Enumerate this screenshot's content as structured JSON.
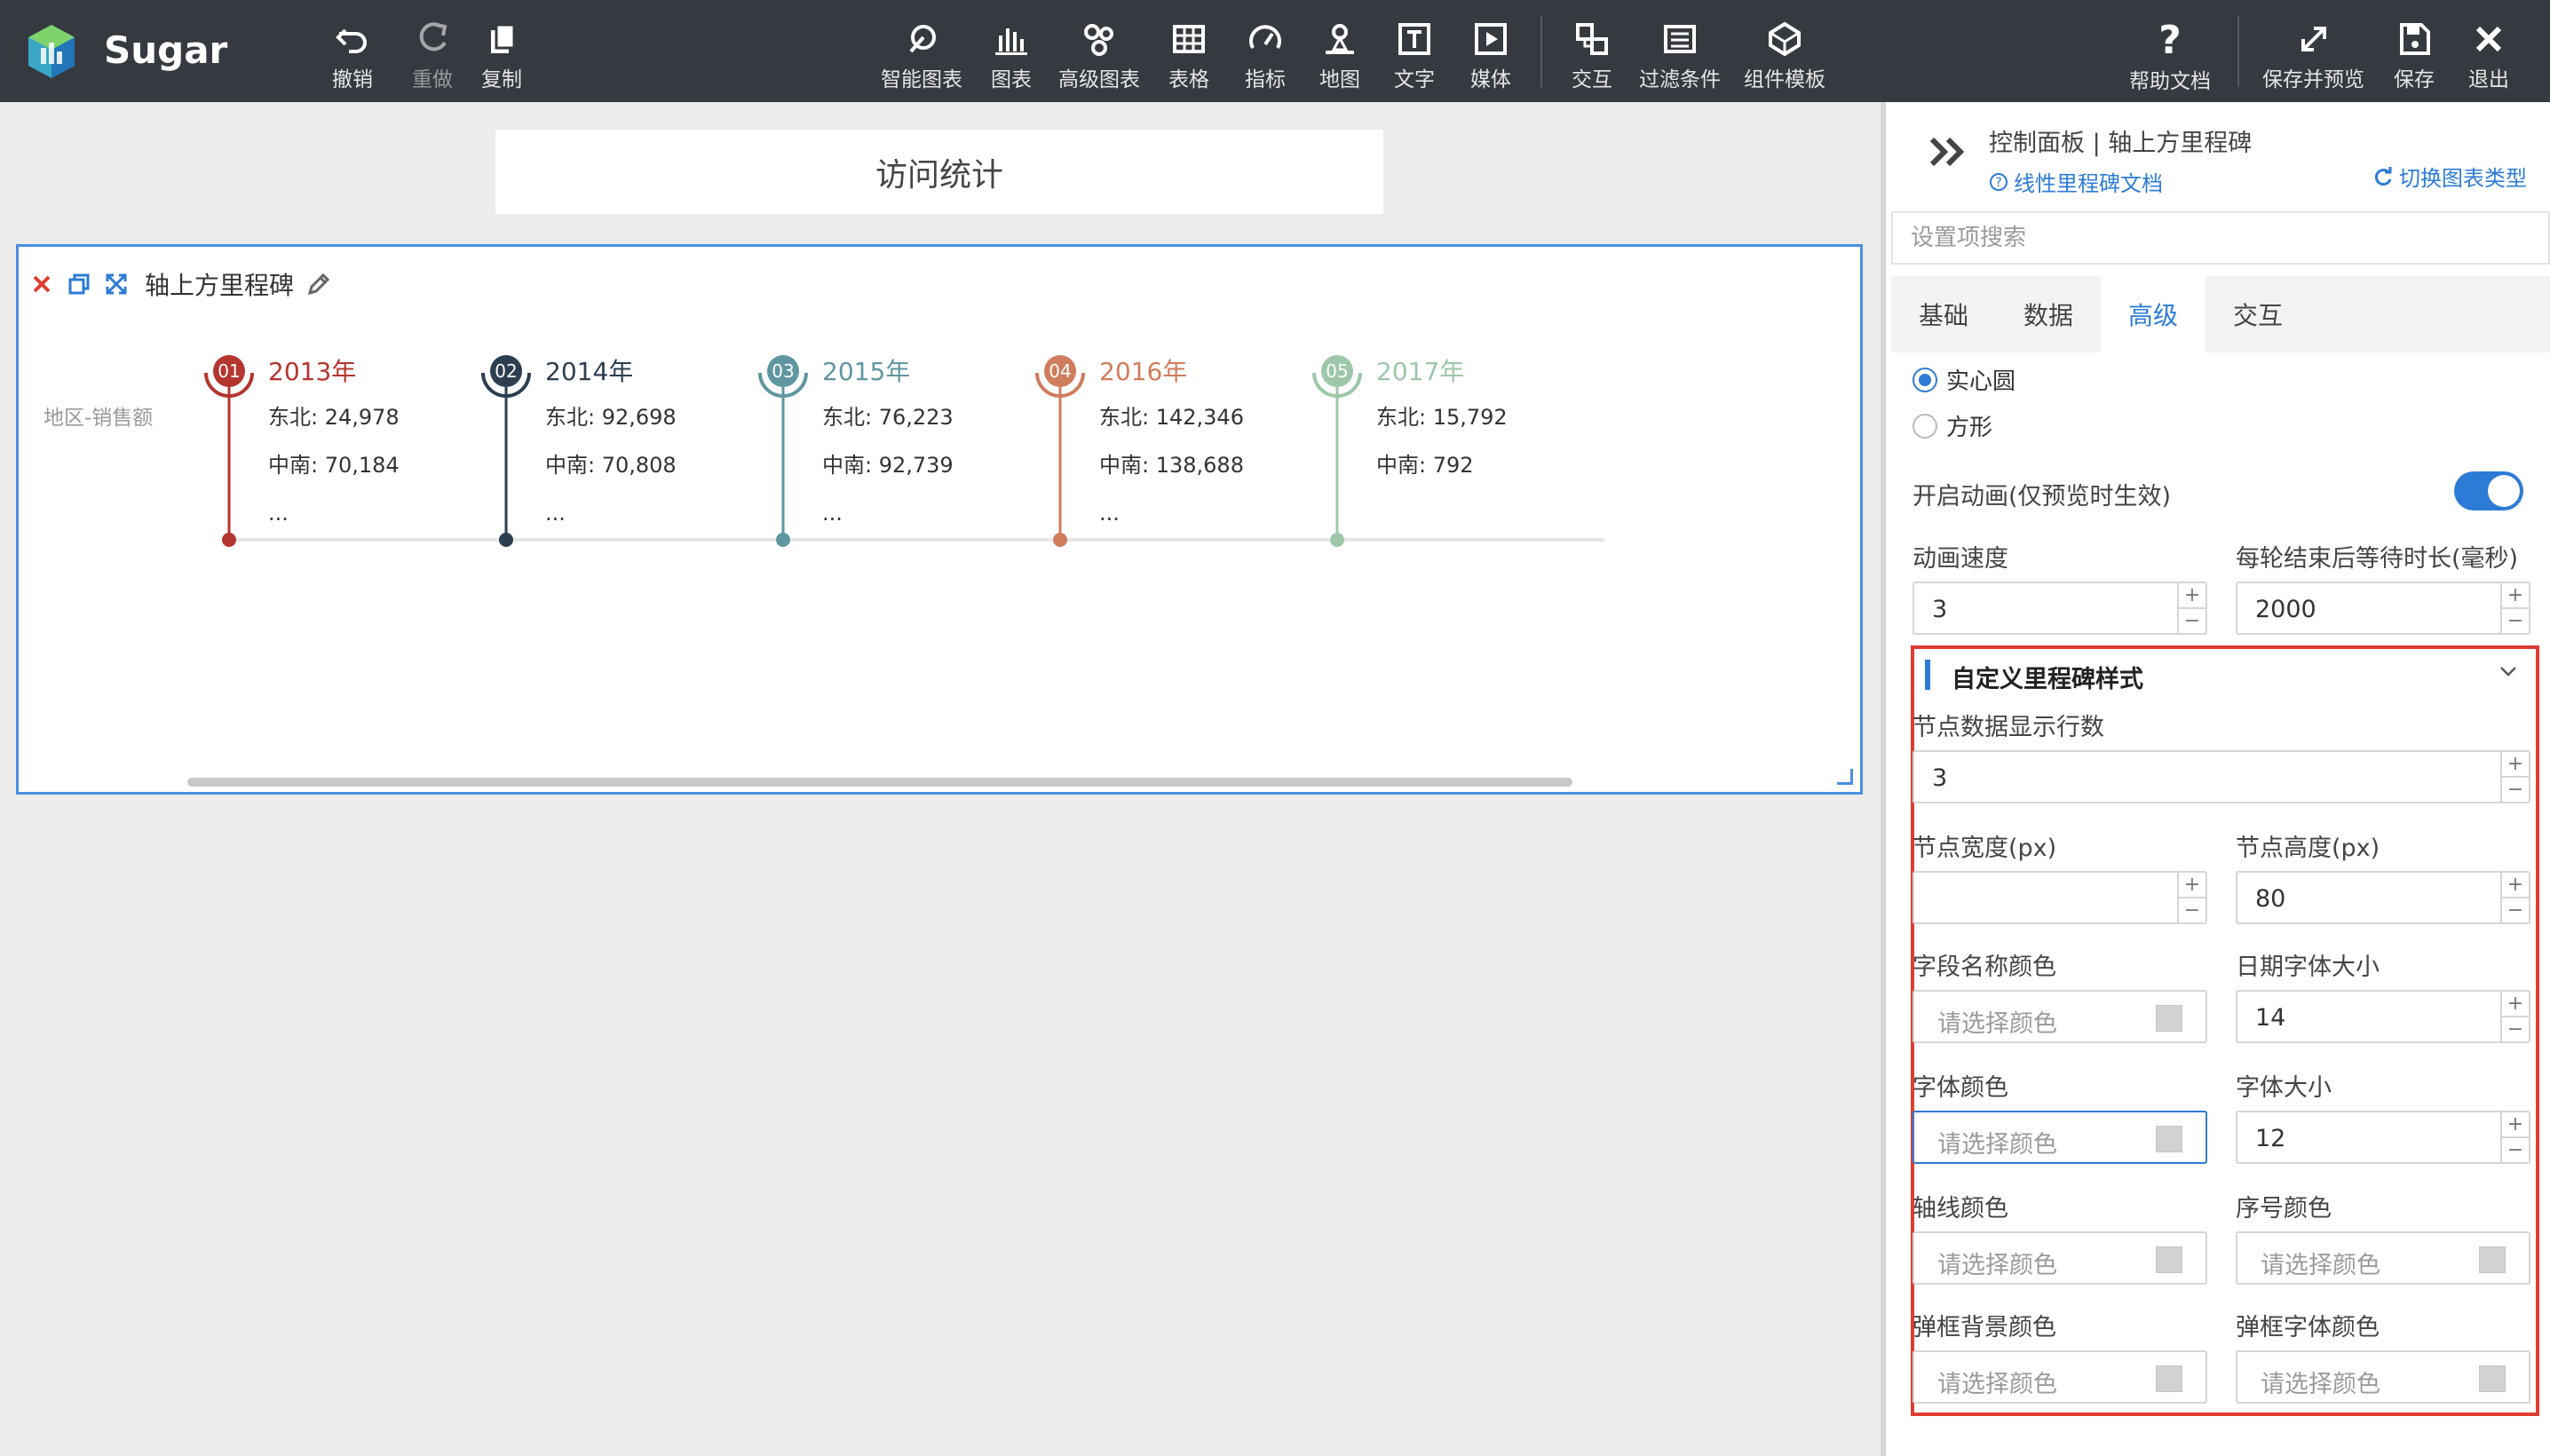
{
  "app": {
    "brand": "Sugar",
    "toolbar_left": [
      {
        "label": "撤销",
        "icon": "undo-icon"
      },
      {
        "label": "重做",
        "icon": "redo-icon"
      },
      {
        "label": "复制",
        "icon": "copy-icon"
      }
    ],
    "toolbar_center": [
      {
        "label": "智能图表",
        "icon": "smart-chart-icon"
      },
      {
        "label": "图表",
        "icon": "bar-chart-icon"
      },
      {
        "label": "高级图表",
        "icon": "advanced-chart-icon"
      },
      {
        "label": "表格",
        "icon": "table-icon"
      },
      {
        "label": "指标",
        "icon": "gauge-icon"
      },
      {
        "label": "地图",
        "icon": "map-pin-icon"
      },
      {
        "label": "文字",
        "icon": "text-icon"
      },
      {
        "label": "媒体",
        "icon": "media-icon"
      },
      {
        "label": "交互",
        "icon": "interaction-icon"
      },
      {
        "label": "过滤条件",
        "icon": "filter-icon"
      },
      {
        "label": "组件模板",
        "icon": "template-icon"
      }
    ],
    "toolbar_right": [
      {
        "label": "帮助文档",
        "icon": "help-icon"
      },
      {
        "label": "保存并预览",
        "icon": "expand-icon"
      },
      {
        "label": "保存",
        "icon": "save-icon"
      },
      {
        "label": "退出",
        "icon": "close-icon"
      }
    ]
  },
  "canvas": {
    "page_title": "访问统计",
    "widget": {
      "title": "轴上方里程碑",
      "dimension_label": "地区-销售额",
      "milestones": [
        {
          "index": "01",
          "year": "2013年",
          "color": "#b5352f",
          "lines": [
            "东北: 24,978",
            "中南: 70,184",
            "..."
          ]
        },
        {
          "index": "02",
          "year": "2014年",
          "color": "#2c3e50",
          "lines": [
            "东北: 92,698",
            "中南: 70,808",
            "..."
          ]
        },
        {
          "index": "03",
          "year": "2015年",
          "color": "#5f96a1",
          "lines": [
            "东北: 76,223",
            "中南: 92,739",
            "..."
          ]
        },
        {
          "index": "04",
          "year": "2016年",
          "color": "#cf7d5c",
          "lines": [
            "东北: 142,346",
            "中南: 138,688",
            "..."
          ]
        },
        {
          "index": "05",
          "year": "2017年",
          "color": "#9dc7a8",
          "lines": [
            "东北: 15,792",
            "中南: 792"
          ]
        }
      ]
    }
  },
  "panel": {
    "header_title": "控制面板 | 轴上方里程碑",
    "doc_link": "线性里程碑文档",
    "switch_link": "切换图表类型",
    "search_placeholder": "设置项搜索",
    "tabs": [
      "基础",
      "数据",
      "高级",
      "交互"
    ],
    "active_tab": "高级",
    "shape_options": [
      "实心圆",
      "方形"
    ],
    "selected_shape": "实心圆",
    "animation_label": "开启动画(仅预览时生效)",
    "animation_on": true,
    "anim_speed_label": "动画速度",
    "anim_speed_value": "3",
    "wait_label": "每轮结束后等待时长(毫秒)",
    "wait_value": "2000",
    "section_title": "自定义里程碑样式",
    "rows_label": "节点数据显示行数",
    "rows_value": "3",
    "node_width_label": "节点宽度(px)",
    "node_width_value": "",
    "node_height_label": "节点高度(px)",
    "node_height_value": "80",
    "field_color_label": "字段名称颜色",
    "date_size_label": "日期字体大小",
    "date_size_value": "14",
    "font_color_label": "字体颜色",
    "font_size_label": "字体大小",
    "font_size_value": "12",
    "axis_color_label": "轴线颜色",
    "seq_color_label": "序号颜色",
    "popup_bg_label": "弹框背景颜色",
    "popup_font_label": "弹框字体颜色",
    "color_placeholder": "请选择颜色"
  }
}
